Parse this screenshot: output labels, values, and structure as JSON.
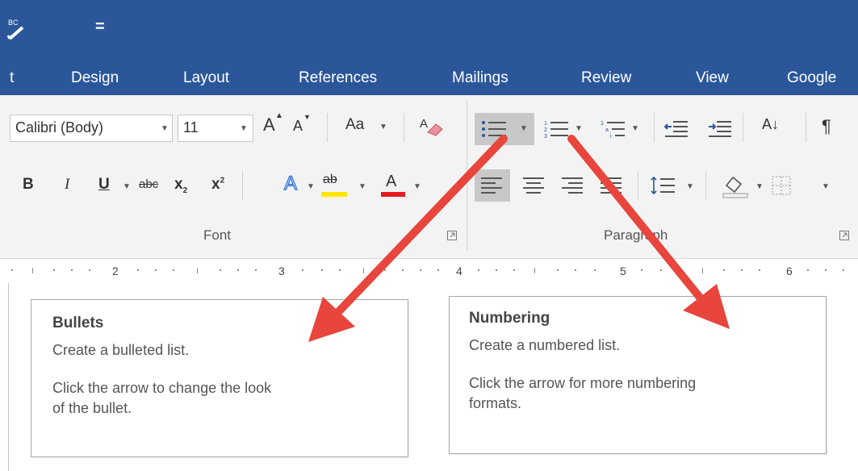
{
  "titlebar": {
    "quick_access": "="
  },
  "tabs": [
    "t",
    "Design",
    "Layout",
    "References",
    "Mailings",
    "Review",
    "View",
    "Google"
  ],
  "font_group": {
    "font_name": "Calibri (Body)",
    "font_size": "11",
    "grow_label": "A",
    "shrink_label": "A",
    "change_case": "Aa",
    "bold": "B",
    "italic": "I",
    "underline": "U",
    "strikethrough": "abc",
    "subscript": "x",
    "superscript": "x",
    "text_effects": "A",
    "highlight": "ab",
    "font_color": "A",
    "label": "Font"
  },
  "paragraph_group": {
    "sort": "A↓",
    "pilcrow": "¶",
    "label": "Paragraph"
  },
  "ruler": [
    "2",
    "3",
    "4",
    "5",
    "6"
  ],
  "tooltips": {
    "bullets": {
      "title": "Bullets",
      "line1": "Create a bulleted list.",
      "line2": "Click the arrow to change the look",
      "line3": "of the bullet."
    },
    "numbering": {
      "title": "Numbering",
      "line1": "Create a numbered list.",
      "line2": "Click the arrow for more numbering",
      "line3": "formats."
    }
  },
  "colors": {
    "title_bar": "#2b579a",
    "arrow": "#e8453c",
    "highlight": "#ffe600",
    "font_color": "#e31c23"
  }
}
